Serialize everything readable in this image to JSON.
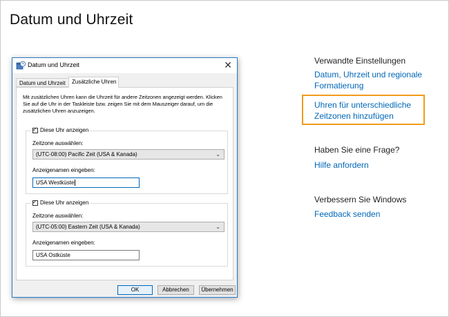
{
  "page": {
    "title": "Datum und Uhrzeit"
  },
  "related": {
    "heading": "Verwandte Einstellungen",
    "links": [
      "Datum, Uhrzeit und regionale",
      "Formatierung",
      "Uhren für unterschiedliche",
      "Zeitzonen hinzufügen"
    ]
  },
  "question": {
    "heading": "Haben Sie eine Frage?",
    "link": "Hilfe anfordern"
  },
  "improve": {
    "heading": "Verbessern Sie Windows",
    "link": "Feedback senden"
  },
  "dialog": {
    "title": "Datum und Uhrzeit",
    "close_glyph": "✕",
    "tabs": [
      "Datum und Uhrzeit",
      "Zusätzliche Uhren"
    ],
    "description": "Mit zusätzlichen Uhren kann die Uhrzeit für andere Zeitzonen angezeigt werden. Klicken Sie auf die Uhr in der Taskleiste bzw. zeigen Sie mit dem Mauszeiger darauf, um die zusätzlichen Uhren anzuzeigen.",
    "clock1": {
      "show_label": "Diese Uhr anzeigen",
      "checked": true,
      "timezone_label": "Zeitzone auswählen:",
      "timezone_value": "(UTC-08:00) Pacific Zeit (USA & Kanada)",
      "name_label": "Anzeigenamen eingeben:",
      "name_value": "USA Westküste"
    },
    "clock2": {
      "show_label": "Diese Uhr anzeigen",
      "checked": true,
      "timezone_label": "Zeitzone auswählen:",
      "timezone_value": "(UTC-05:00) Eastern Zeit (USA & Kanada)",
      "name_label": "Anzeigenamen eingeben:",
      "name_value": "USA Ostküste"
    },
    "buttons": {
      "ok": "OK",
      "cancel": "Abbrechen",
      "apply": "Übernehmen"
    }
  },
  "colors": {
    "link": "#0067b8",
    "highlight": "#f39a1b",
    "dialog_border": "#2b78c8"
  }
}
